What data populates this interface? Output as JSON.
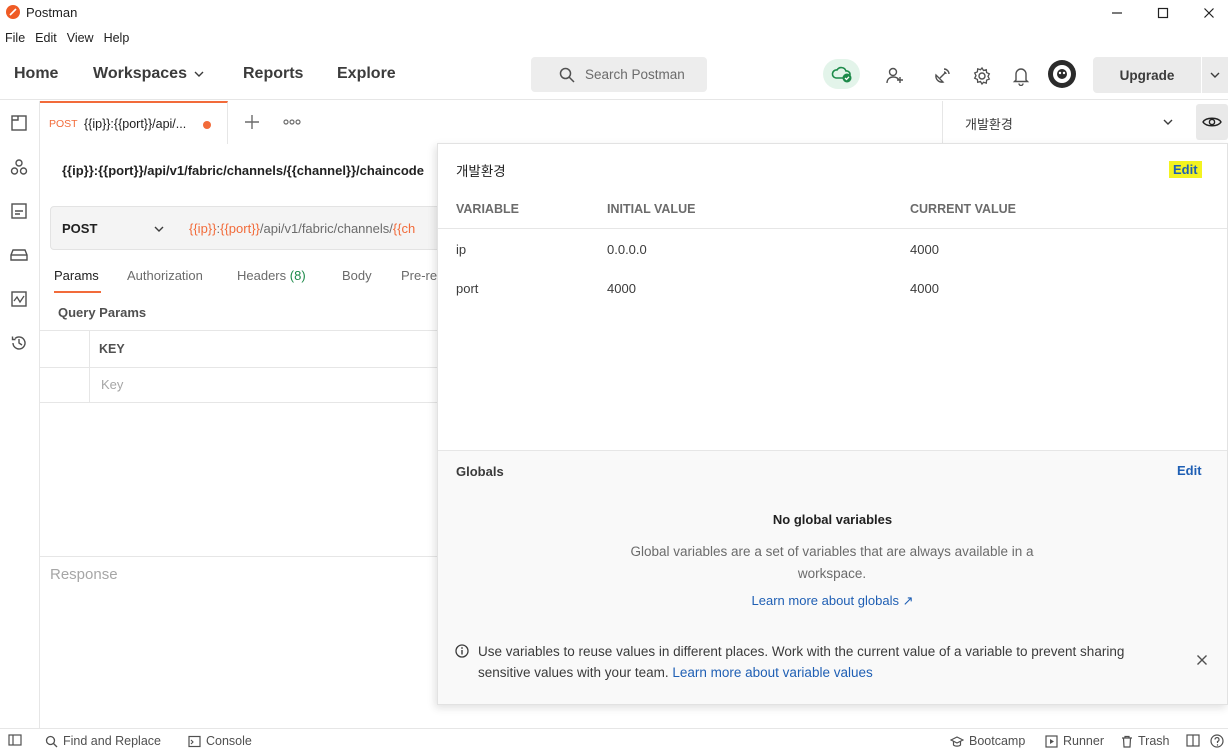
{
  "window": {
    "title": "Postman"
  },
  "menu": [
    "File",
    "Edit",
    "View",
    "Help"
  ],
  "nav": {
    "home": "Home",
    "workspaces": "Workspaces",
    "reports": "Reports",
    "explore": "Explore"
  },
  "search": {
    "placeholder": "Search Postman"
  },
  "upgrade_label": "Upgrade",
  "tab": {
    "method": "POST",
    "title": "{{ip}}:{{port}}/api/...",
    "unsaved": true
  },
  "environment": {
    "selected": "개발환경"
  },
  "request": {
    "title": "{{ip}}:{{port}}/api/v1/fabric/channels/{{channel}}/chaincode",
    "method": "POST",
    "url_parts": [
      {
        "text": "{{ip}}",
        "var": true
      },
      {
        "text": ":",
        "var": false
      },
      {
        "text": "{{port}}",
        "var": true
      },
      {
        "text": "/api/v1/fabric/channels/",
        "var": false
      },
      {
        "text": "{{ch",
        "var": true
      }
    ],
    "tabs": {
      "params": "Params",
      "authorization": "Authorization",
      "headers": "Headers",
      "headers_count": "(8)",
      "body": "Body",
      "pre": "Pre-re"
    },
    "query_params_label": "Query Params",
    "key_header": "KEY",
    "key_placeholder": "Key"
  },
  "response_label": "Response",
  "popover": {
    "env_title": "개발환경",
    "edit_label": "Edit",
    "columns": [
      "VARIABLE",
      "INITIAL VALUE",
      "CURRENT VALUE"
    ],
    "variables": [
      {
        "name": "ip",
        "initial": "0.0.0.0",
        "current": "4000"
      },
      {
        "name": "port",
        "initial": "4000",
        "current": "4000"
      }
    ],
    "globals": {
      "title": "Globals",
      "edit_label": "Edit",
      "empty_title": "No global variables",
      "empty_desc": "Global variables are a set of variables that are always available in a workspace.",
      "learn_link": "Learn more about globals ↗"
    },
    "info": {
      "text": "Use variables to reuse values in different places. Work with the current value of a variable to prevent sharing sensitive values with your team.",
      "link": "Learn more about variable values"
    }
  },
  "statusbar": {
    "find_replace": "Find and Replace",
    "console": "Console",
    "bootcamp": "Bootcamp",
    "runner": "Runner",
    "trash": "Trash"
  },
  "colors": {
    "accent": "#f26b3a",
    "link": "#1f5fb4",
    "highlight": "#f3f320"
  }
}
